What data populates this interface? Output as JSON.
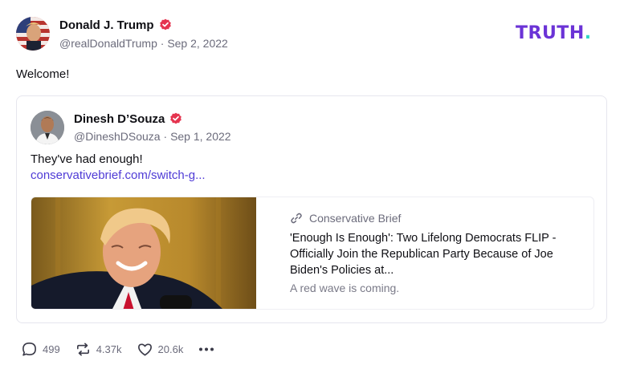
{
  "post": {
    "author_name": "Donald J. Trump",
    "handle": "@realDonaldTrump",
    "date": "Sep 2, 2022",
    "text": "Welcome!",
    "brand": "TRUTH",
    "brand_dot": ".",
    "verified_icon": "verified-check-icon"
  },
  "quote": {
    "author_name": "Dinesh D’Souza",
    "handle": "@DineshDSouza",
    "date": "Sep 1, 2022",
    "text": "They've had enough!",
    "link_text": "conservativebrief.com/switch-g...",
    "preview": {
      "source": "Conservative Brief",
      "title": "'Enough Is Enough': Two Lifelong Democrats FLIP - Officially Join the Republican Party Because of Joe Biden's Policies at...",
      "description": "A red wave is coming."
    }
  },
  "actions": {
    "replies": "499",
    "retruths": "4.37k",
    "likes": "20.6k"
  },
  "colors": {
    "brand_purple": "#6b33d6",
    "brand_teal": "#2fd6c4",
    "verified": "#e5344f",
    "link": "#4f3bd6"
  },
  "separator": " · "
}
